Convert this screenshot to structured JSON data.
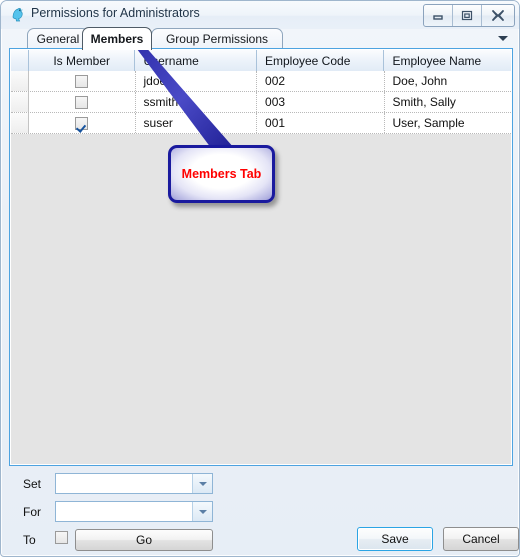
{
  "window": {
    "title": "Permissions for Administrators",
    "icon": "bird-icon",
    "controls": [
      {
        "name": "minimize-button",
        "glyph": "minimize"
      },
      {
        "name": "maximize-button",
        "glyph": "maximize"
      },
      {
        "name": "close-button",
        "glyph": "close"
      }
    ]
  },
  "tabs": {
    "items": [
      {
        "label": "General",
        "selected": false
      },
      {
        "label": "Members",
        "selected": true
      },
      {
        "label": "Group Permissions",
        "selected": false
      }
    ],
    "overflow_icon": "chevron-down-icon"
  },
  "grid": {
    "columns": [
      "Is Member",
      "Username",
      "Employee Code",
      "Employee Name"
    ],
    "rows": [
      {
        "is_member": false,
        "username": "jdoe",
        "employee_code": "002",
        "employee_name": "Doe, John"
      },
      {
        "is_member": false,
        "username": "ssmith",
        "employee_code": "003",
        "employee_name": "Smith, Sally"
      },
      {
        "is_member": true,
        "username": "suser",
        "employee_code": "001",
        "employee_name": "User, Sample"
      }
    ]
  },
  "callout": {
    "text": "Members Tab",
    "text_color": "#ff0000",
    "border_color": "#1a1a9e"
  },
  "bottom": {
    "set_label": "Set",
    "set_value": "",
    "set_placeholder": "",
    "for_label": "For",
    "for_value": "",
    "for_placeholder": "",
    "to_label": "To",
    "to_checked": false,
    "go_label": "Go",
    "save_label": "Save",
    "cancel_label": "Cancel"
  },
  "colors": {
    "accent": "#4da3e0",
    "grid_empty": "#e4e4e4",
    "header_text": "#11161c"
  }
}
